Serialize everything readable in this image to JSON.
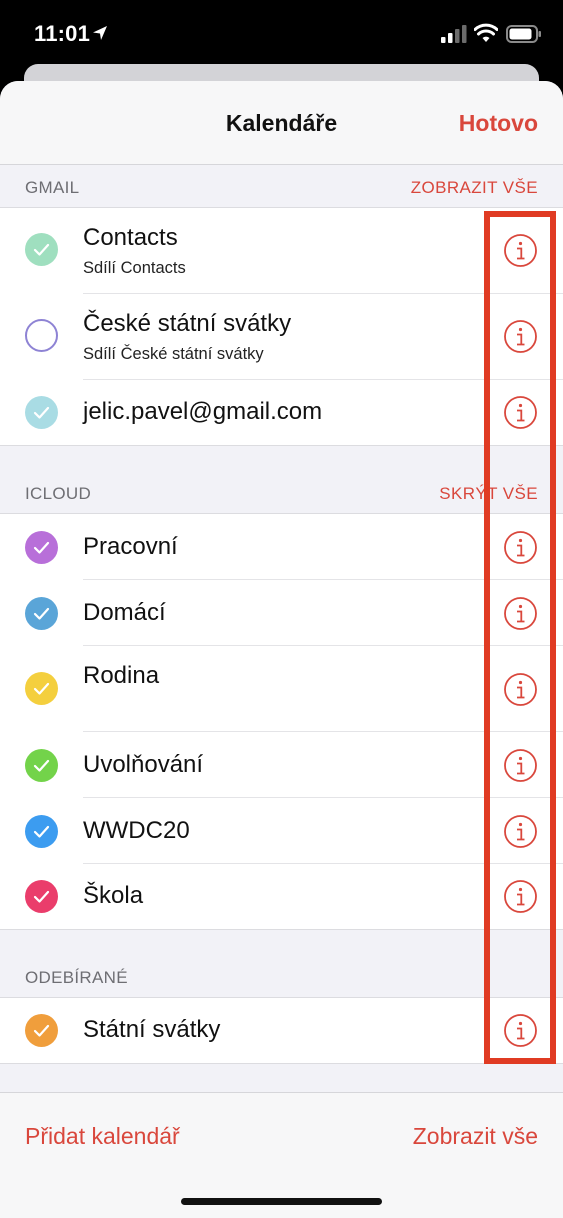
{
  "status": {
    "time": "11:01"
  },
  "nav": {
    "title": "Kalendáře",
    "done": "Hotovo"
  },
  "sections": [
    {
      "title": "GMAIL",
      "action": "ZOBRAZIT VŠE",
      "rows": [
        {
          "title": "Contacts",
          "subtitle": "Sdílí Contacts",
          "color": "#9fdfbf",
          "checked": true
        },
        {
          "title": "České státní svátky",
          "subtitle": "Sdílí České státní svátky",
          "color": "#8e83d4",
          "checked": false
        },
        {
          "title": "jelic.pavel@gmail.com",
          "color": "#a9dce4",
          "checked": true
        }
      ]
    },
    {
      "title": "ICLOUD",
      "action": "SKRÝT VŠE",
      "rows": [
        {
          "title": "Pracovní",
          "color": "#b86fd9",
          "checked": true
        },
        {
          "title": "Domácí",
          "color": "#5aa5d8",
          "checked": true
        },
        {
          "title": "Rodina",
          "color": "#f4cf3e",
          "checked": true
        },
        {
          "title": "Uvolňování",
          "color": "#73d34a",
          "checked": true
        },
        {
          "title": "WWDC20",
          "color": "#3c9cf0",
          "checked": true
        },
        {
          "title": "Škola",
          "color": "#ea3d6b",
          "checked": true
        }
      ]
    },
    {
      "title": "ODEBÍRANÉ",
      "action": "",
      "rows": [
        {
          "title": "Státní svátky",
          "color": "#f09e3c",
          "checked": true
        }
      ]
    }
  ],
  "toolbar": {
    "add": "Přidat kalendář",
    "show_all": "Zobrazit vše"
  },
  "colors": {
    "accent": "#d9473c",
    "highlight": "#e03b23"
  },
  "icons": {
    "info": "info-circle-icon",
    "check": "checkmark-icon"
  }
}
